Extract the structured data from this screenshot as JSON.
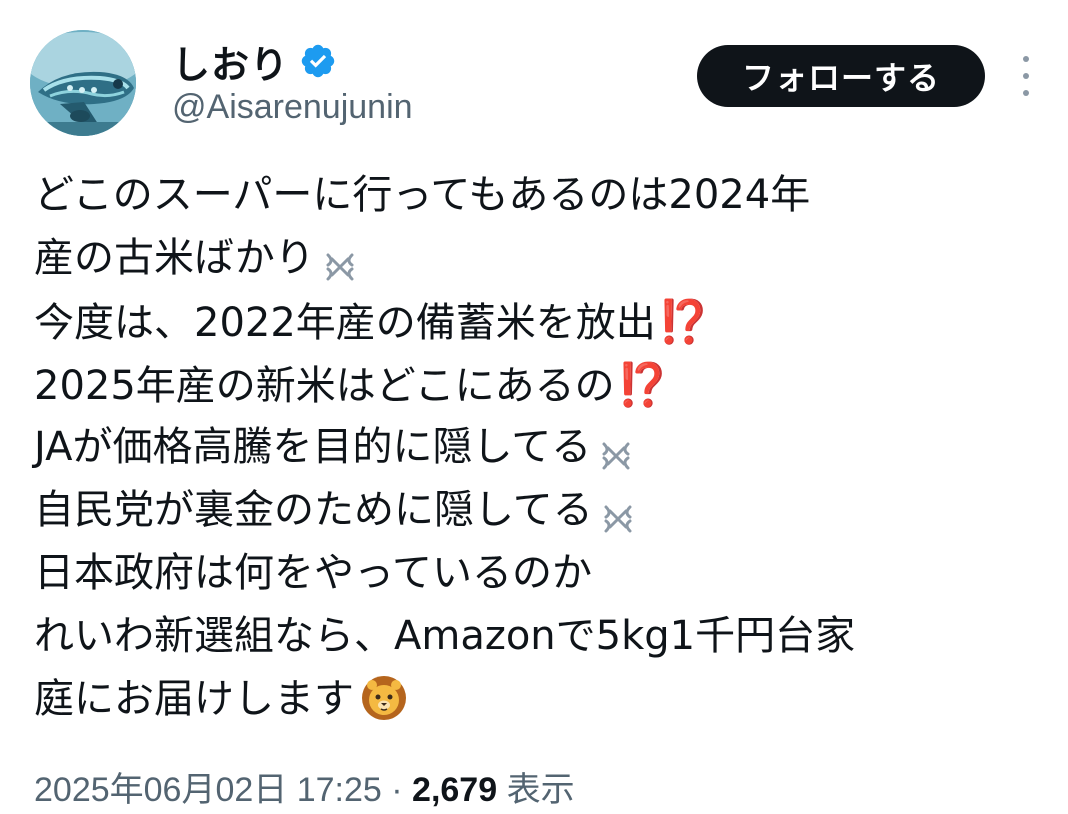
{
  "user": {
    "display_name": "しおり",
    "handle": "@Aisarenujunin",
    "verified": true,
    "avatar": "airplane-avatar"
  },
  "header": {
    "follow_label": "フォローする",
    "more_icon": "more-vertical-icon"
  },
  "tweet": {
    "lines": [
      "どこのスーパーに行ってもあるのは2024年",
      "産の古米ばかり",
      "今度は、2022年産の備蓄米を放出",
      "2025年産の新米はどこにあるの",
      "JAが価格高騰を目的に隠してる",
      "自民党が裏金のために隠してる",
      "日本政府は何をやっているのか",
      "れいわ新選組なら、Amazonで5kg1千円台家",
      "庭にお届けします"
    ],
    "interrobang": "⁉️"
  },
  "meta": {
    "date": "2025年06月02日 17:25",
    "separator": "·",
    "views_count": "2,679",
    "views_label": "表示"
  },
  "colors": {
    "text": "#0f1419",
    "secondary": "#536471",
    "verified": "#1d9bf0",
    "interrobang": "#e23ee0",
    "button_bg": "#0f1419"
  }
}
